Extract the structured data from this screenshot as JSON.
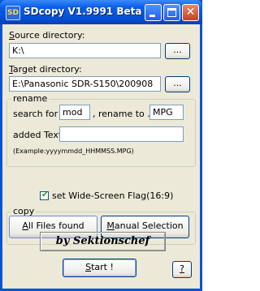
{
  "window": {
    "title": "SDcopy V1.9991 Beta",
    "icon_text": "SD"
  },
  "source": {
    "label": "Source directory:",
    "underline": "S",
    "rest": "ource directory:",
    "value": "K:\\",
    "browse_label": "..."
  },
  "target": {
    "label": "Target directory:",
    "underline": "T",
    "rest": "arget directory:",
    "value": "E:\\Panasonic SDR-S150\\200908",
    "browse_label": "..."
  },
  "rename": {
    "group_label": "rename",
    "search_label": "search for .",
    "search_value": "mod",
    "rename_label": ", rename to .",
    "rename_value": "MPG",
    "added_label": "added Text",
    "added_value": "",
    "example": "(Example:yyyymmdd_HHMMSS.MPG)"
  },
  "widescreen": {
    "label": "set Wide-Screen Flag(16:9)",
    "checked": true
  },
  "copy": {
    "group_label": "copy",
    "all_files_label": "All Files found",
    "all_underline": "A",
    "all_rest": "ll Files found",
    "manual_label": "Manual Selection",
    "manual_underline": "M",
    "manual_rest": "anual Selection"
  },
  "credit": "by Sektionschef",
  "start": {
    "label": "Start !",
    "underline": "S",
    "rest": "tart !"
  },
  "help": {
    "label": "?"
  }
}
